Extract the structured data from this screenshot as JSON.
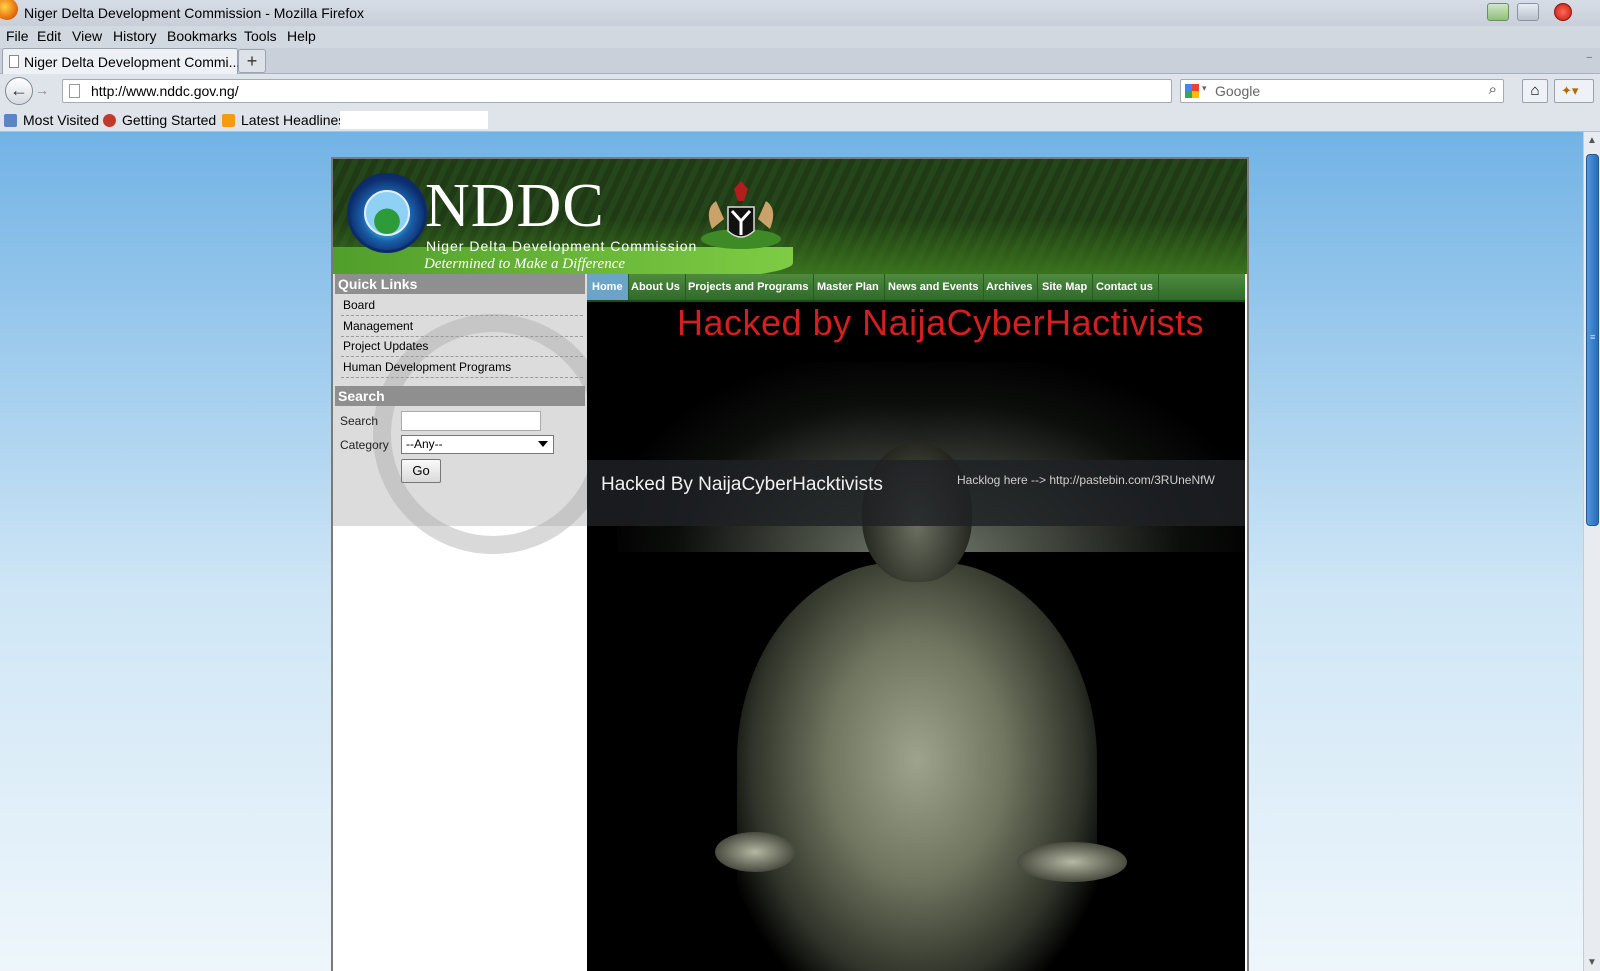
{
  "window": {
    "title": "Niger Delta Development Commission - Mozilla Firefox"
  },
  "menubar": {
    "items": [
      "File",
      "Edit",
      "View",
      "History",
      "Bookmarks",
      "Tools",
      "Help"
    ]
  },
  "tabs": [
    {
      "label": "Niger Delta Development Commi..."
    }
  ],
  "navbar": {
    "url": "http://www.nddc.gov.ng/",
    "search_placeholder": "Google"
  },
  "bookmarks": [
    {
      "label": "Most Visited",
      "icon": "bookmark-folder-icon"
    },
    {
      "label": "Getting Started",
      "icon": "firefox-icon"
    },
    {
      "label": "Latest Headlines",
      "icon": "rss-icon"
    }
  ],
  "site": {
    "name": "NDDC",
    "full_name": "Niger Delta Development Commission",
    "tagline": "Determined to Make a Difference",
    "quick_links": {
      "heading": "Quick Links",
      "items": [
        "Board",
        "Management",
        "Project Updates",
        "Human Development Programs"
      ]
    },
    "search": {
      "heading": "Search",
      "search_label": "Search",
      "search_value": "",
      "category_label": "Category",
      "category_value": "--Any--",
      "go_label": "Go"
    },
    "nav": [
      "Home",
      "About Us",
      "Projects and Programs",
      "Master Plan",
      "News and Events",
      "Archives",
      "Site Map",
      "Contact us"
    ],
    "active_nav": "Home",
    "defacement": {
      "banner": "Hacked by NaijaCyberHactivists",
      "title": "Hacked By NaijaCyberHacktivists",
      "hacklog": "Hacklog here --> http://pastebin.com/3RUneNfW"
    }
  },
  "colors": {
    "header_green": "#25451a",
    "nav_active": "#6aa5c9",
    "banner_red": "#d31f1f",
    "scroll_thumb": "#2a6db8"
  }
}
